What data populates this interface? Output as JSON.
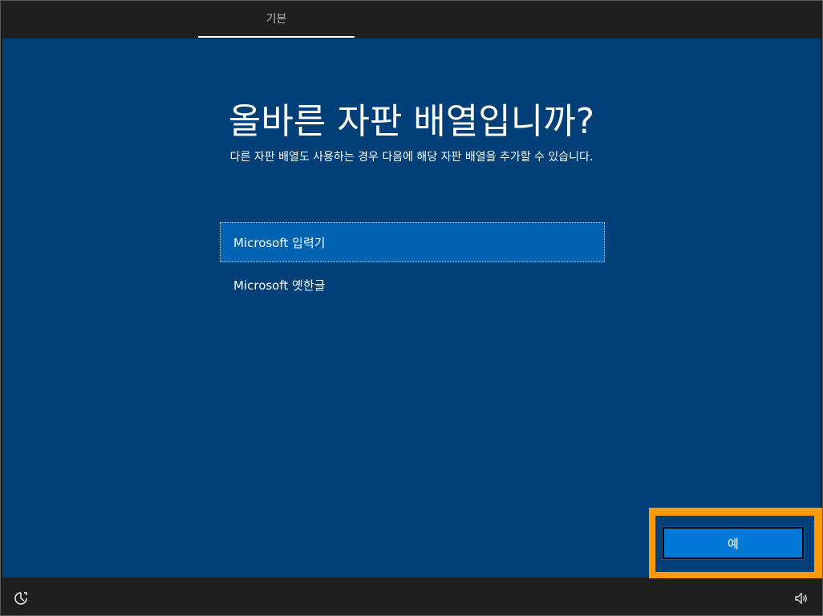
{
  "header": {
    "tab_label": "기본"
  },
  "main": {
    "title": "올바른 자판 배열입니까?",
    "subtitle": "다른 자판 배열도 사용하는 경우 다음에 해당 자판 배열을 추가할 수 있습니다.",
    "layouts": [
      {
        "label": "Microsoft 입력기",
        "selected": true
      },
      {
        "label": "Microsoft 옛한글",
        "selected": false
      }
    ]
  },
  "actions": {
    "yes_label": "예"
  },
  "footer": {
    "left_icon": "ease-of-access-icon",
    "right_icon": "volume-icon"
  },
  "colors": {
    "background": "#003f77",
    "selected_item": "#0063b1",
    "button": "#0078d7",
    "highlight": "#ff9a00",
    "bar": "#1f1f1f"
  }
}
